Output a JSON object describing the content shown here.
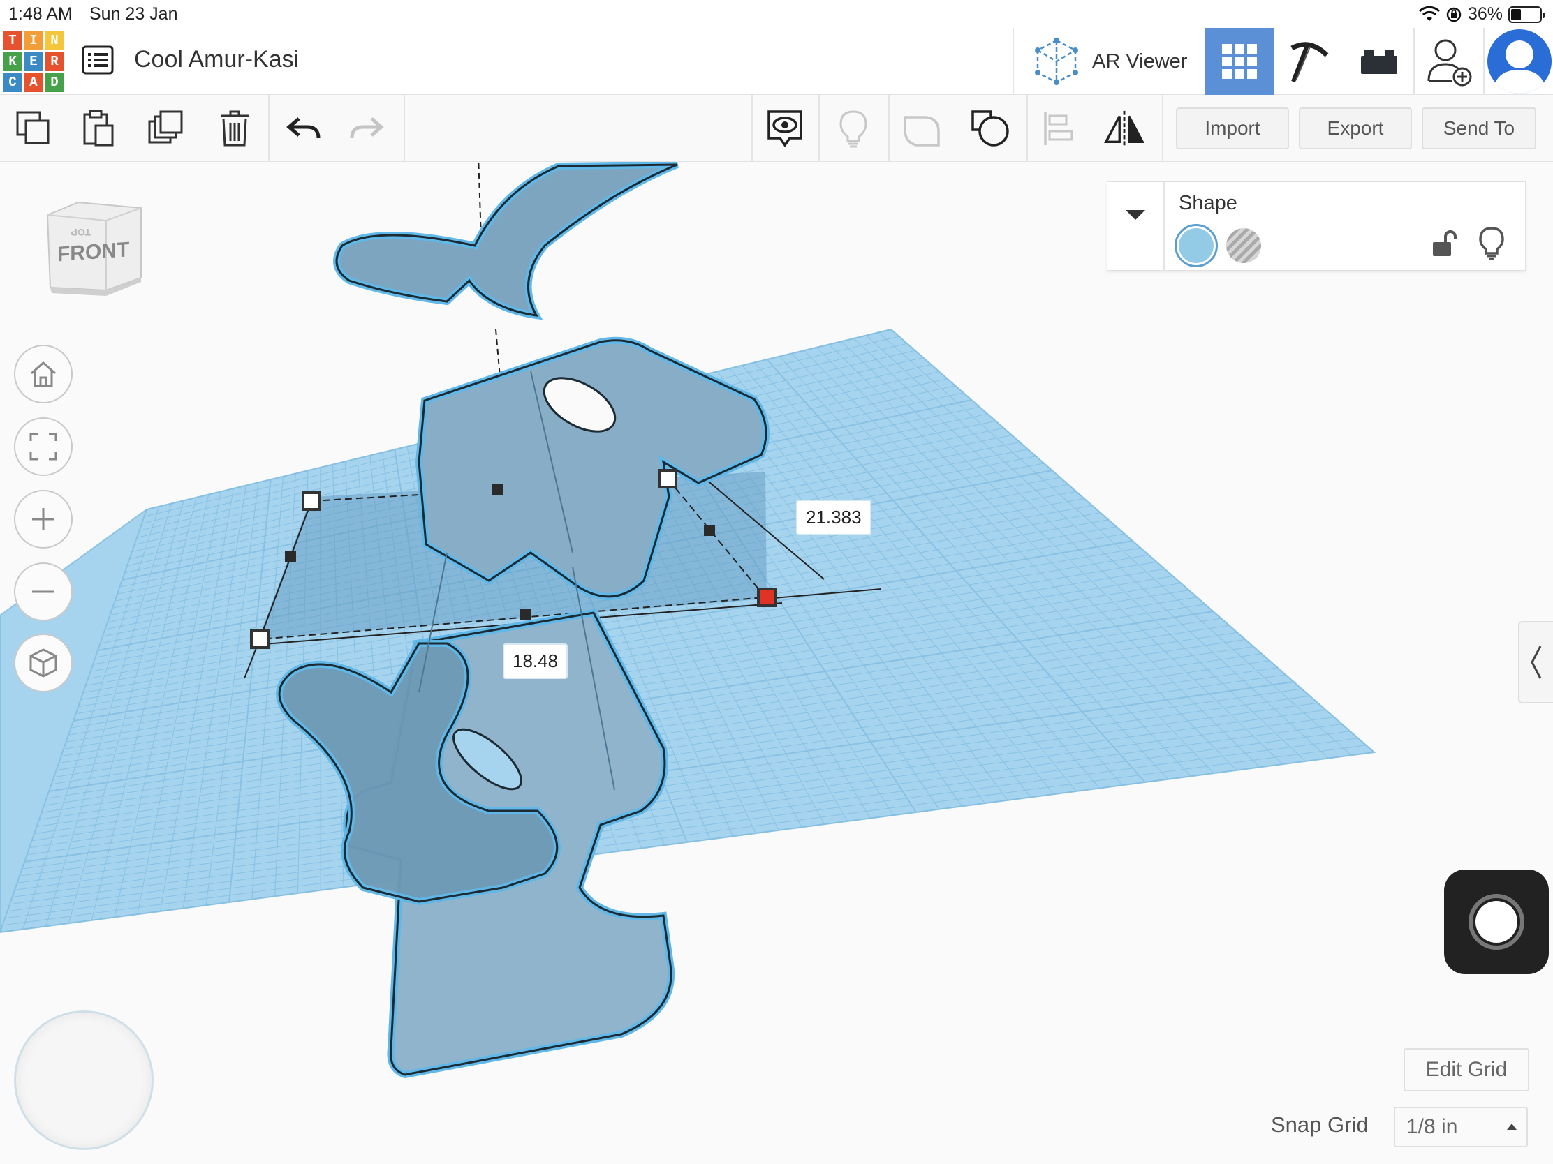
{
  "status_bar": {
    "time": "1:48 AM",
    "date": "Sun 23 Jan",
    "battery_percent": "36%",
    "battery_level": 0.36
  },
  "header": {
    "logo_letters": [
      "T",
      "I",
      "N",
      "K",
      "E",
      "R",
      "C",
      "A",
      "D"
    ],
    "logo_colors": [
      "#e5522d",
      "#f29d38",
      "#f4c63b",
      "#45a14a",
      "#3c8ac4",
      "#e5522d",
      "#3c8ac4",
      "#e5522d",
      "#45a14a"
    ],
    "design_name": "Cool Amur-Kasi",
    "ar_viewer_label": "AR Viewer"
  },
  "toolbar": {
    "import_label": "Import",
    "export_label": "Export",
    "send_to_label": "Send To"
  },
  "view_cube": {
    "front_label": "FRONT",
    "top_label": "TOP"
  },
  "inspector": {
    "title": "Shape",
    "solid_color": "#93cbe6"
  },
  "dimensions": {
    "depth": "21.383",
    "width": "18.48"
  },
  "grid_controls": {
    "edit_grid_label": "Edit Grid",
    "snap_grid_label": "Snap Grid",
    "snap_grid_value": "1/8 in"
  },
  "colors": {
    "shape_fill": "#8fb4cc",
    "shape_outline": "#5fb8e8",
    "workplane": "#a6d4ee",
    "accent": "#5b8fd6",
    "handle_active": "#e03325"
  }
}
